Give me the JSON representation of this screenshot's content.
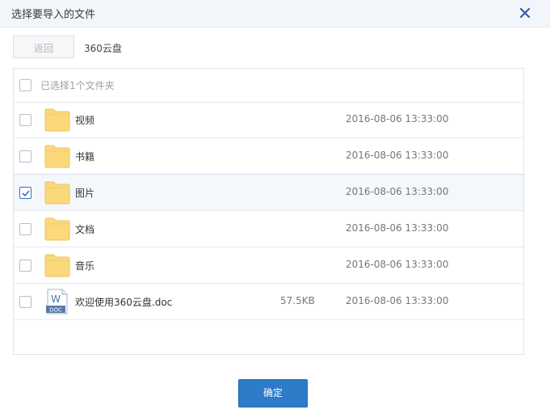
{
  "dialog": {
    "title": "选择要导入的文件",
    "close_icon": "close-icon",
    "confirm_label": "确定"
  },
  "toolbar": {
    "back_label": "返回",
    "path": "360云盘"
  },
  "list": {
    "header_label": "已选择1个文件夹",
    "rows": [
      {
        "name": "视频",
        "size": "",
        "modified": "2016-08-06 13:33:00",
        "type": "folder",
        "checked": false
      },
      {
        "name": "书籍",
        "size": "",
        "modified": "2016-08-06 13:33:00",
        "type": "folder",
        "checked": false
      },
      {
        "name": "图片",
        "size": "",
        "modified": "2016-08-06 13:33:00",
        "type": "folder",
        "checked": true
      },
      {
        "name": "文档",
        "size": "",
        "modified": "2016-08-06 13:33:00",
        "type": "folder",
        "checked": false
      },
      {
        "name": "音乐",
        "size": "",
        "modified": "2016-08-06 13:33:00",
        "type": "folder",
        "checked": false
      },
      {
        "name": "欢迎使用360云盘.doc",
        "size": "57.5KB",
        "modified": "2016-08-06 13:33:00",
        "type": "doc",
        "checked": false,
        "icon_text": "DOC",
        "icon_letter": "W"
      }
    ]
  },
  "colors": {
    "accent": "#2d7bc9",
    "check": "#3a6fb6",
    "folder": "#fbd97b"
  }
}
